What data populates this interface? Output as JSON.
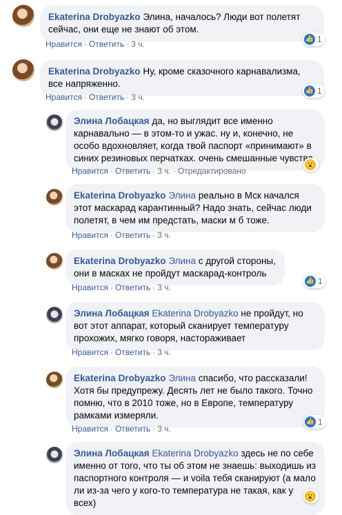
{
  "labels": {
    "like": "Нравится",
    "reply": "Ответить",
    "dot": "·"
  },
  "comments": [
    {
      "author": "Ekaterina Drobyazko",
      "mention": "",
      "text": "Элина, началось? Люди вот полетят сейчас, они еще не знают об этом.",
      "time": "3 ч.",
      "edited": "",
      "reaction": {
        "icon": "like-icon",
        "count": "1"
      }
    },
    {
      "author": "Ekaterina Drobyazko",
      "mention": "",
      "text": "Ну, кроме сказочного карнавализма, все напряженно.",
      "time": "3 ч.",
      "edited": "",
      "reaction": {
        "icon": "like-icon",
        "count": "1"
      }
    },
    {
      "author": "Элина Лобацкая",
      "mention": "",
      "text": "да, но выглядит все именно карнавально — в этом-то и ужас. ну и, конечно, не особо вдохновляет, когда твой паспорт «принимают» в синих резиновых перчатках. очень смешанные чувства",
      "time": "3 ч.",
      "edited": "Отредактировано",
      "reaction": {
        "icon": "wow-icon",
        "count": ""
      }
    },
    {
      "author": "Ekaterina Drobyazko",
      "mention": "Элина",
      "text": "реально в Мск начался этот маскарад карантинный? Надо знать, сейчас люди полетят, в чем им предстать, маски м б тоже.",
      "time": "3 ч.",
      "edited": "",
      "reaction": null
    },
    {
      "author": "Ekaterina Drobyazko",
      "mention": "Элина",
      "text": "с другой стороны, они в масках не пройдут маскарад-контроль",
      "time": "3 ч.",
      "edited": "",
      "reaction": {
        "icon": "like-icon",
        "count": "1"
      }
    },
    {
      "author": "Элина Лобацкая",
      "mention": "Ekaterina Drobyazko",
      "text": "не пройдут, но вот этот аппарат, который сканирует температуру прохожих, мягко говоря, настораживает",
      "time": "3 ч.",
      "edited": "",
      "reaction": null
    },
    {
      "author": "Ekaterina Drobyazko",
      "mention": "Элина",
      "text": "спасибо, что рассказали! Хотя бы предупрежу. Десять лет не было такого. Точно помню, что в 2010 тоже, но в Европе, температуру рамками измеряли.",
      "time": "3 ч.",
      "edited": "",
      "reaction": {
        "icon": "like-icon",
        "count": "1"
      }
    },
    {
      "author": "Элина Лобацкая",
      "mention": "Ekaterina Drobyazko",
      "text": "здесь не по себе именно от того, что ты об этом не знаешь: выходишь из паспортного контроля — и voila тебя сканируют (а мало ли из-за чего у кого-то температура не такая, как у всех)",
      "time": "",
      "edited": "",
      "reaction": {
        "icon": "wow-icon",
        "count": ""
      }
    }
  ]
}
